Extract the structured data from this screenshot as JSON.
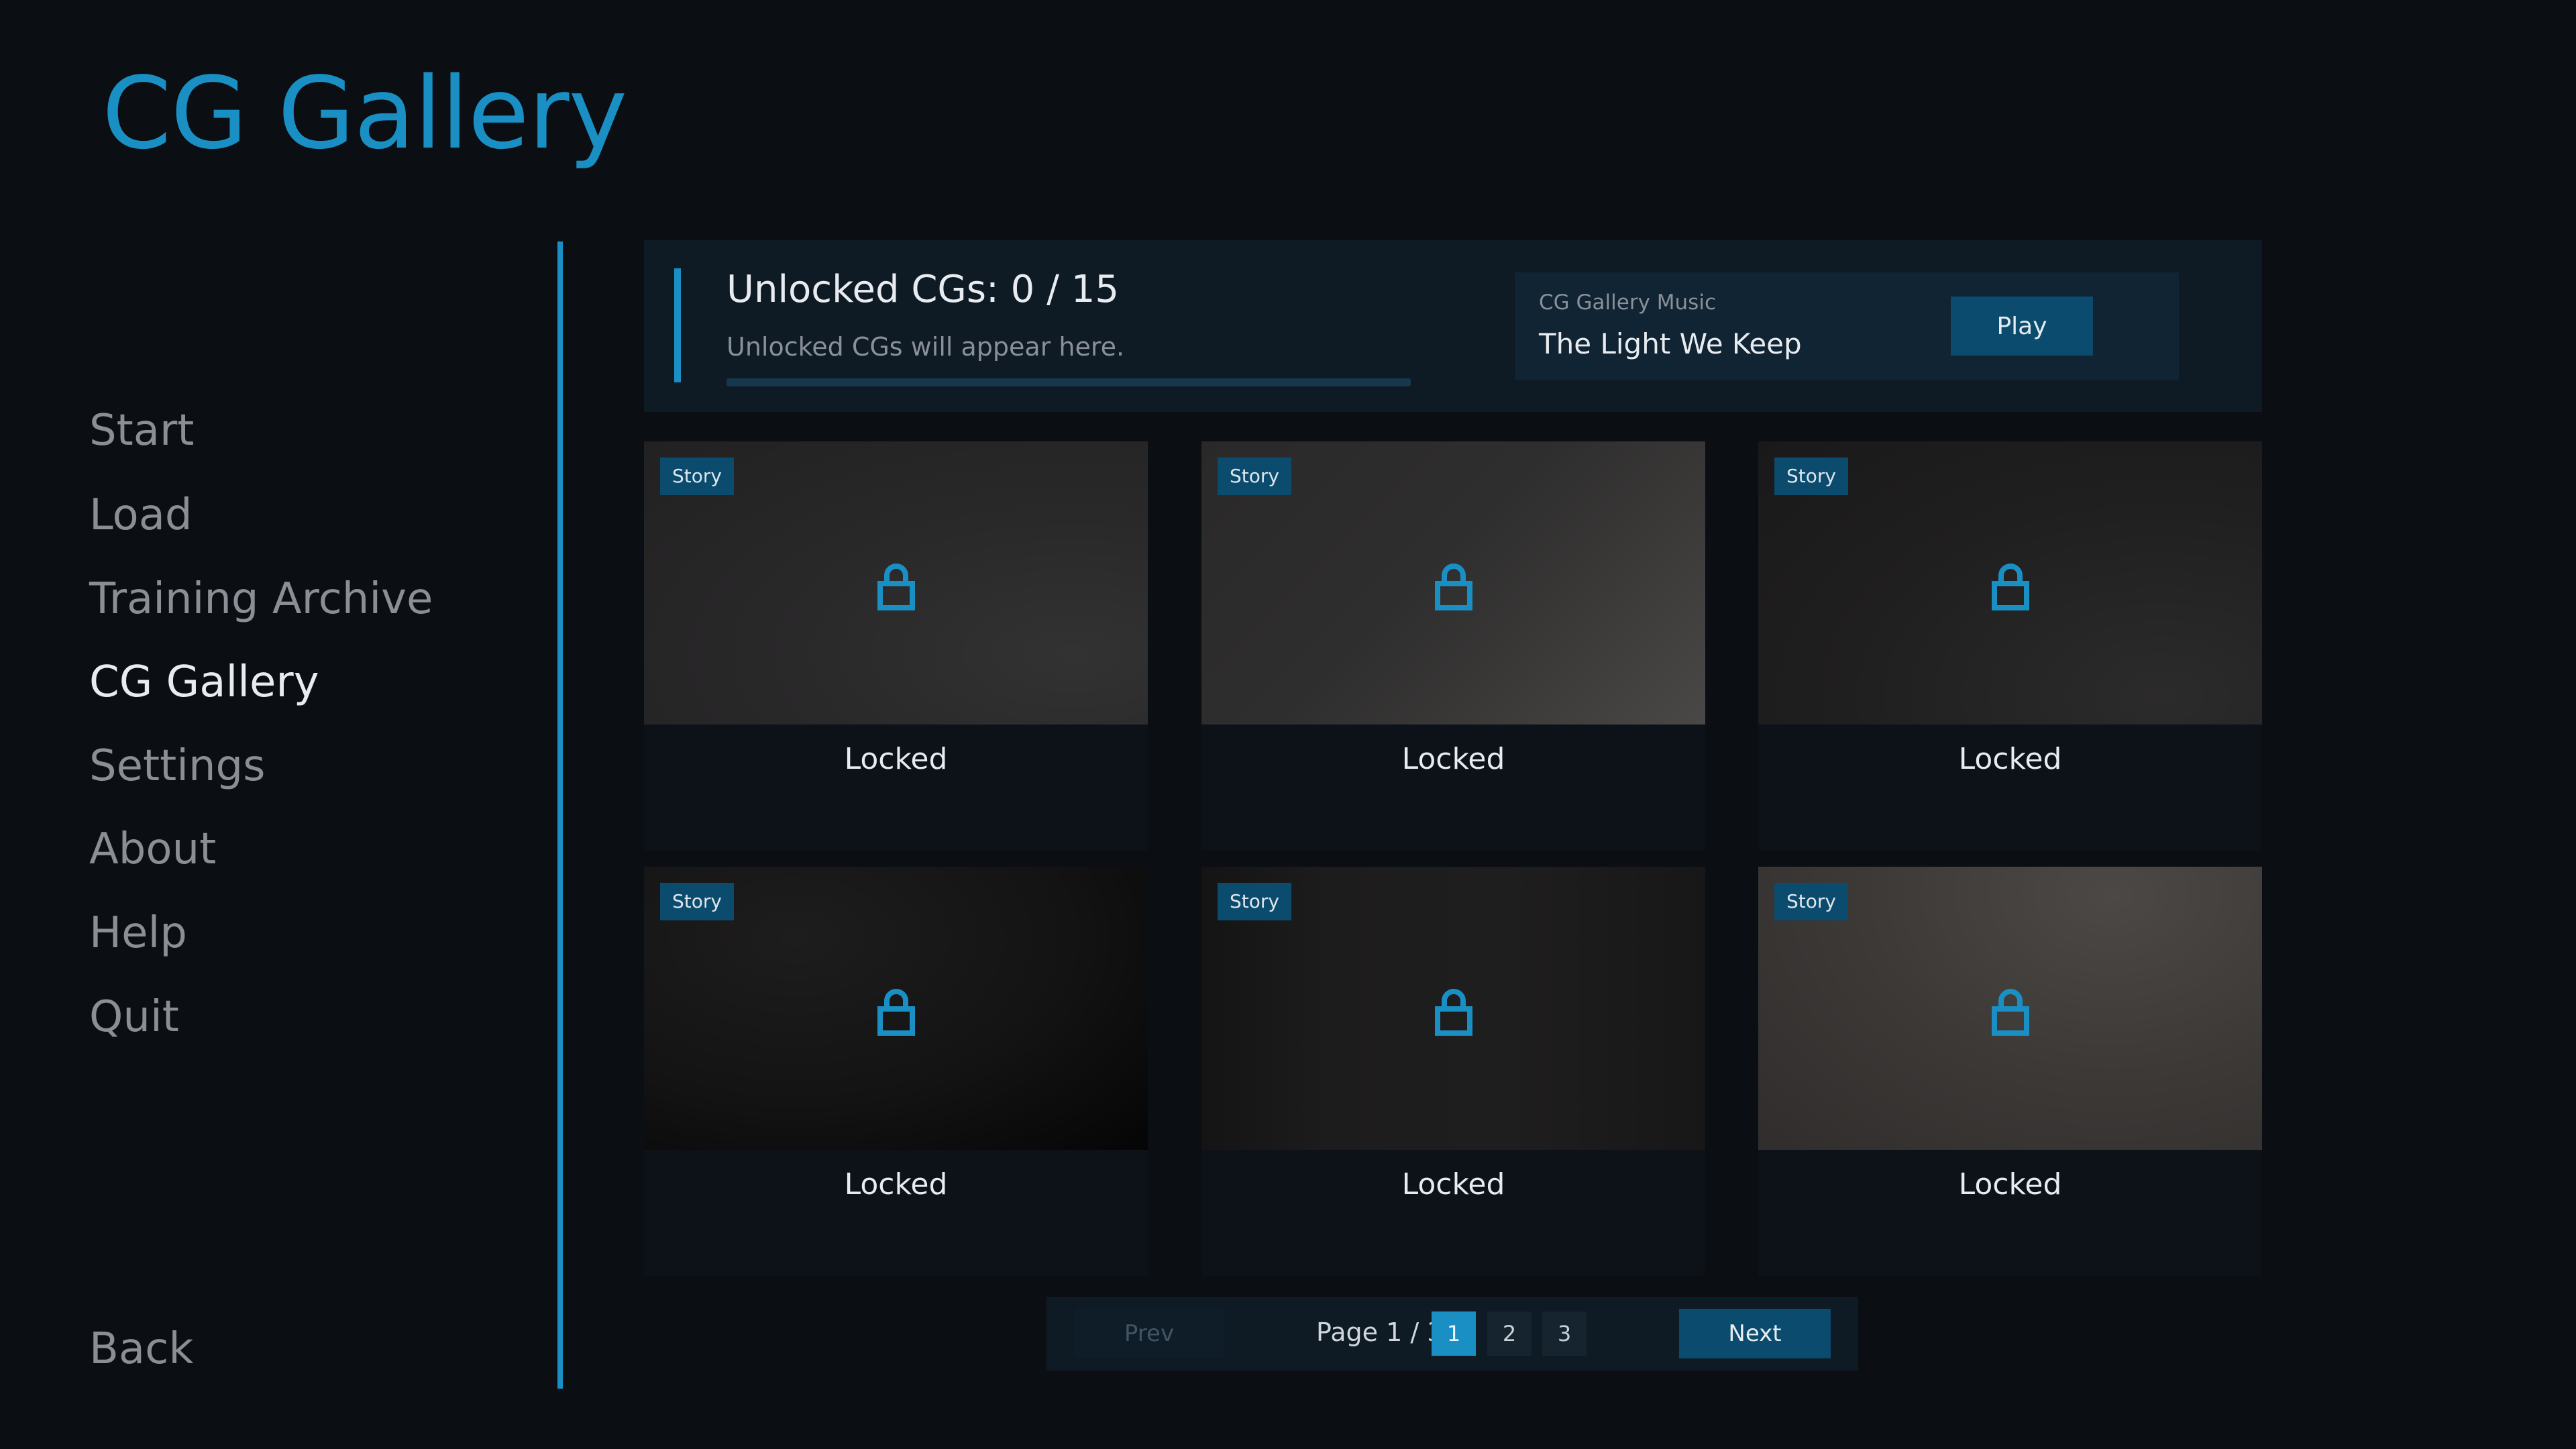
{
  "title": "CG Gallery",
  "nav": {
    "items": [
      {
        "label": "Start",
        "name": "nav-start"
      },
      {
        "label": "Load",
        "name": "nav-load"
      },
      {
        "label": "Training Archive",
        "name": "nav-training-archive"
      },
      {
        "label": "CG Gallery",
        "name": "nav-cg-gallery",
        "active": true
      },
      {
        "label": "Settings",
        "name": "nav-settings"
      },
      {
        "label": "About",
        "name": "nav-about"
      },
      {
        "label": "Help",
        "name": "nav-help"
      },
      {
        "label": "Quit",
        "name": "nav-quit"
      }
    ],
    "back": "Back"
  },
  "banner": {
    "heading": "Unlocked CGs: 0 / 15",
    "subtext": "Unlocked CGs will appear here.",
    "progress": 0,
    "music": {
      "label": "CG Gallery Music",
      "track": "The Light We Keep",
      "play_label": "Play"
    }
  },
  "cards": [
    {
      "tag": "Story",
      "label": "Locked",
      "icon": "lock-icon"
    },
    {
      "tag": "Story",
      "label": "Locked",
      "icon": "lock-icon"
    },
    {
      "tag": "Story",
      "label": "Locked",
      "icon": "lock-icon"
    },
    {
      "tag": "Story",
      "label": "Locked",
      "icon": "lock-icon"
    },
    {
      "tag": "Story",
      "label": "Locked",
      "icon": "lock-icon"
    },
    {
      "tag": "Story",
      "label": "Locked",
      "icon": "lock-icon"
    }
  ],
  "pager": {
    "prev": "Prev",
    "next": "Next",
    "info": "Page 1 / 3",
    "pages": [
      "1",
      "2",
      "3"
    ],
    "current": "1"
  },
  "colors": {
    "accent": "#1a8fc4",
    "background": "#0b0e12",
    "button": "#0a4b6e"
  }
}
